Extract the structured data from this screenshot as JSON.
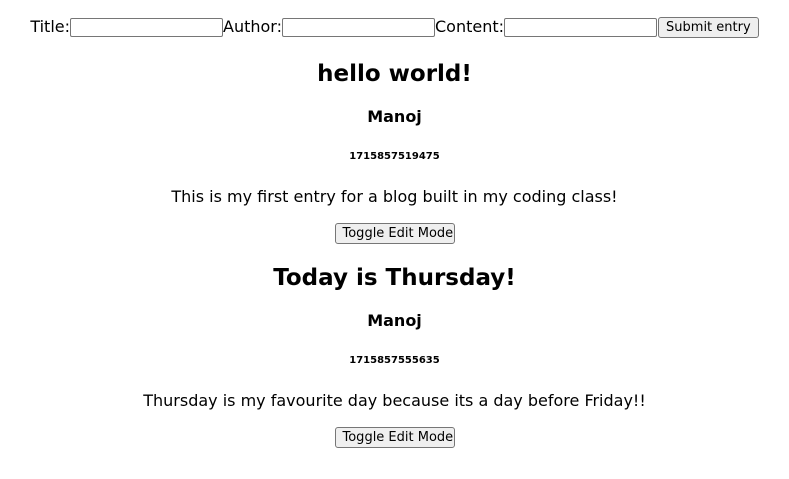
{
  "form": {
    "title_label": "Title:",
    "author_label": "Author:",
    "content_label": "Content:",
    "title_value": "",
    "author_value": "",
    "content_value": "",
    "submit_label": "Submit entry"
  },
  "entries": [
    {
      "title": "hello world!",
      "author": "Manoj",
      "timestamp": "1715857519475",
      "content": "This is my first entry for a blog built in my coding class!",
      "toggle_label": "Toggle Edit Mode"
    },
    {
      "title": "Today is Thursday!",
      "author": "Manoj",
      "timestamp": "1715857555635",
      "content": "Thursday is my favourite day because its a day before Friday!!",
      "toggle_label": "Toggle Edit Mode"
    }
  ]
}
